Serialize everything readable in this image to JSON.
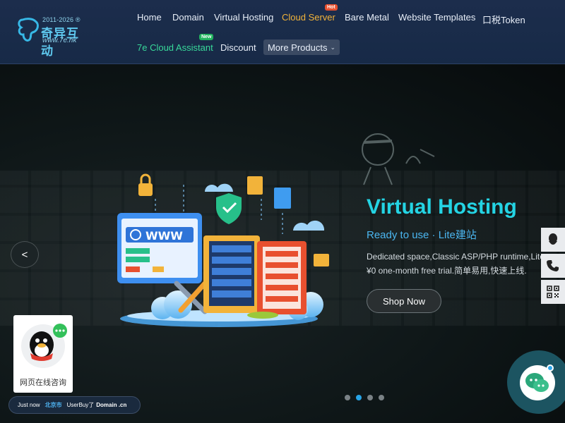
{
  "brand": {
    "years": "2011-2026",
    "registered": "®",
    "name_cn": "奇异互动",
    "url": "www.7e.hk"
  },
  "nav": {
    "row1": [
      {
        "label": "Home"
      },
      {
        "label": "Domain"
      },
      {
        "label": "Virtual Hosting"
      },
      {
        "label": "Cloud Server",
        "badge": "Hot",
        "active": true
      },
      {
        "label": "Bare Metal"
      },
      {
        "label": "Website Templates"
      },
      {
        "label": "口税Token"
      }
    ],
    "row2": [
      {
        "label": "7e Cloud Assistant",
        "badge": "New"
      },
      {
        "label": "Discount"
      }
    ],
    "more": "More Products"
  },
  "hero": {
    "title": "Virtual Hosting",
    "subtitle": "Ready to use · Lite建站",
    "desc_line1": "Dedicated space,Classic ASP/PHP runtime,Lite",
    "desc_line2": "¥0 one-month free trial.简单易用,快速上线.",
    "cta": "Shop Now",
    "prev": "<",
    "illustration_text": "WWW",
    "slides": 4,
    "active_slide": 2
  },
  "side_tools": [
    {
      "icon": "qq-icon"
    },
    {
      "icon": "phone-icon"
    },
    {
      "icon": "qr-code-icon"
    }
  ],
  "qq_card": {
    "label": "网页在线咨询"
  },
  "ticker": {
    "prefix": "Just now",
    "city": "北京市",
    "middle": "UserBuy了",
    "domain": "Domain .cn"
  },
  "colors": {
    "accent_title": "#24d4e4",
    "nav_active": "#f2b33a",
    "nav_new": "#38d99a",
    "dot_active": "#27a4e6"
  }
}
